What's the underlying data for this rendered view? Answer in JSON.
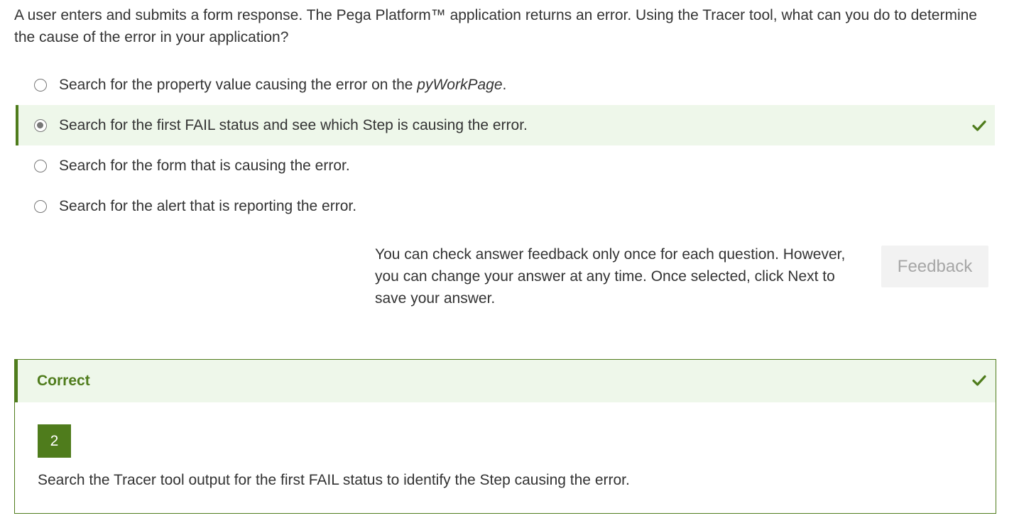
{
  "question": {
    "text": "A user enters and submits a form response. The Pega Platform™ application returns an error. Using the Tracer tool, what can you do to determine the cause of the error in your application?"
  },
  "options": [
    {
      "label_prefix": "Search for the property value causing the error on the ",
      "label_emphasis": "pyWorkPage",
      "label_suffix": ".",
      "selected": false
    },
    {
      "label": "Search for the first FAIL status and see which Step is causing the error.",
      "selected": true,
      "correct_icon": "checkmark-icon"
    },
    {
      "label": "Search for the form that is causing the error.",
      "selected": false
    },
    {
      "label": "Search for the alert that is reporting the error.",
      "selected": false
    }
  ],
  "feedback_note": "You can check answer feedback only once for each question. However, you can change your answer at any time. Once selected, click Next to save your answer.",
  "feedback_button": {
    "label": "Feedback",
    "disabled": true
  },
  "result": {
    "title": "Correct",
    "icon": "checkmark-icon",
    "answer_number": "2",
    "explanation": "Search the Tracer tool output for the first FAIL status to identify the Step causing the error."
  },
  "colors": {
    "accent_green": "#4f7c1c",
    "selected_bg": "#eef7ea",
    "text": "#333333",
    "button_bg": "#f2f2f2",
    "button_text": "#a6a6a6"
  }
}
